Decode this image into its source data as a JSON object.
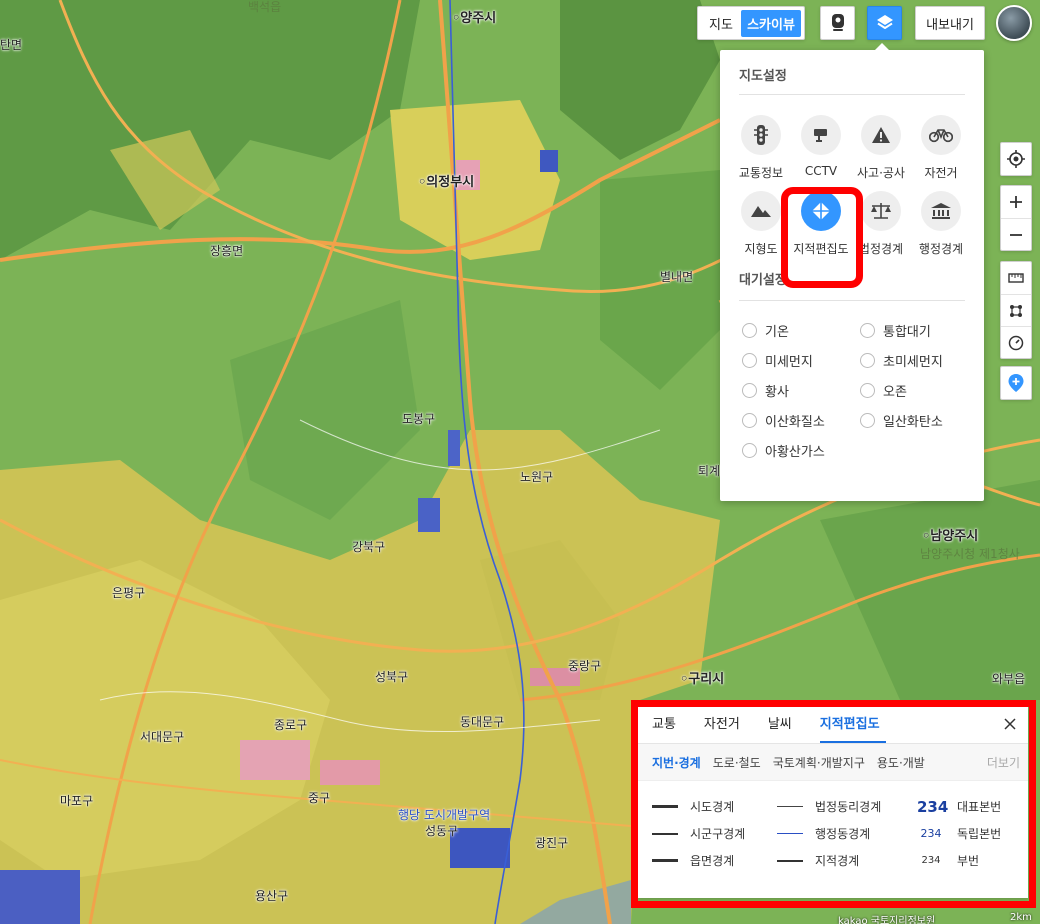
{
  "map": {
    "labels": [
      {
        "text": "백석읍",
        "cls": "faint"
      },
      {
        "text": "양주시",
        "cls": "city"
      },
      {
        "text": "의정부시",
        "cls": "city"
      },
      {
        "text": "장흥면",
        "cls": ""
      },
      {
        "text": "별내면",
        "cls": ""
      },
      {
        "text": "노원구",
        "cls": ""
      },
      {
        "text": "도봉구",
        "cls": ""
      },
      {
        "text": "강북구",
        "cls": ""
      },
      {
        "text": "은평구",
        "cls": ""
      },
      {
        "text": "성북구",
        "cls": ""
      },
      {
        "text": "종로구",
        "cls": ""
      },
      {
        "text": "동대문구",
        "cls": ""
      },
      {
        "text": "중랑구",
        "cls": ""
      },
      {
        "text": "서대문구",
        "cls": ""
      },
      {
        "text": "마포구",
        "cls": ""
      },
      {
        "text": "중구",
        "cls": ""
      },
      {
        "text": "성동구",
        "cls": ""
      },
      {
        "text": "광진구",
        "cls": ""
      },
      {
        "text": "용산구",
        "cls": ""
      },
      {
        "text": "구리시",
        "cls": "city"
      },
      {
        "text": "남양주시",
        "cls": "city"
      },
      {
        "text": "와부읍",
        "cls": ""
      },
      {
        "text": "행당 도시개발구역",
        "cls": "blue"
      },
      {
        "text": "남양주시청 제1청사",
        "cls": "faint"
      },
      {
        "text": "퇴계",
        "cls": ""
      },
      {
        "text": "탄면",
        "cls": ""
      }
    ],
    "copyright": "kakao 국토지리정보원",
    "scale": "2km"
  },
  "topbar": {
    "map_label": "지도",
    "sky_label": "스카이뷰",
    "export_label": "내보내기"
  },
  "settings": {
    "title": "지도설정",
    "items": [
      {
        "label": "교통정보",
        "icon": "traffic-light-icon"
      },
      {
        "label": "CCTV",
        "icon": "cctv-icon"
      },
      {
        "label": "사고·공사",
        "icon": "warning-icon"
      },
      {
        "label": "자전거",
        "icon": "bicycle-icon"
      },
      {
        "label": "지형도",
        "icon": "mountain-icon"
      },
      {
        "label": "지적편집도",
        "icon": "cadastral-icon",
        "active": true
      },
      {
        "label": "법정경계",
        "icon": "scales-icon"
      },
      {
        "label": "행정경계",
        "icon": "government-building-icon"
      }
    ],
    "air_title": "대기설정",
    "air_items": [
      "기온",
      "통합대기",
      "미세먼지",
      "초미세먼지",
      "황사",
      "오존",
      "이산화질소",
      "일산화탄소",
      "아황산가스"
    ]
  },
  "legend": {
    "tabs": [
      "교통",
      "자전거",
      "날씨",
      "지적편집도"
    ],
    "active_tab": 3,
    "subtabs": [
      "지번·경계",
      "도로·철도",
      "국토계획·개발지구",
      "용도·개발"
    ],
    "more": "더보기",
    "col1": [
      "시도경계",
      "시군구경계",
      "읍면경계"
    ],
    "col2": [
      "법정동리경계",
      "행정동경계",
      "지적경계"
    ],
    "col3_num": "234",
    "col3": [
      "대표본번",
      "독립본번",
      "부번"
    ]
  },
  "colors": {
    "accent": "#3396ff",
    "highlight": "#ff0000"
  }
}
